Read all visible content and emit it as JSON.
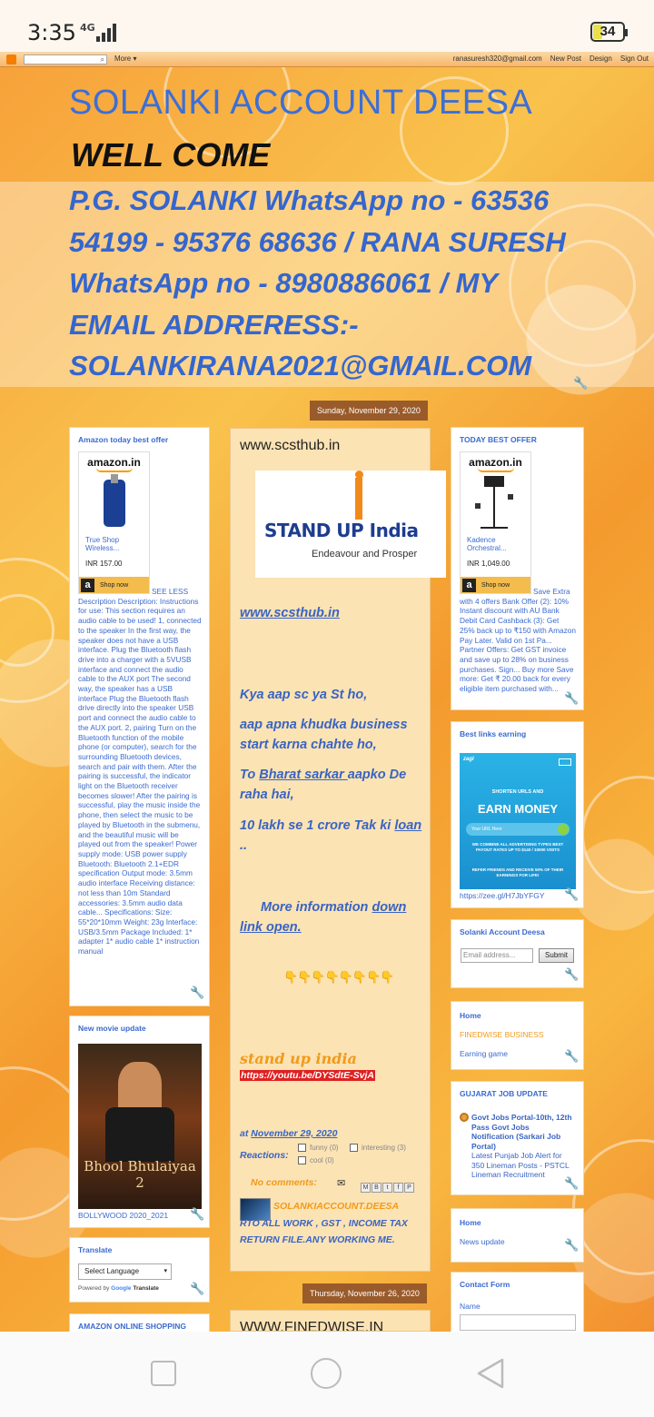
{
  "status": {
    "time": "3:35",
    "network": "4G",
    "battery": "34"
  },
  "navbar": {
    "search_placeholder": "",
    "more_label": "More ▾",
    "email": "ranasuresh320@gmail.com",
    "new_post": "New Post",
    "design": "Design",
    "sign_out": "Sign Out"
  },
  "header": {
    "title": "SOLANKI ACCOUNT DEESA",
    "welcome": "WELL COME",
    "description": "P.G. SOLANKI WhatsApp no - 63536 54199 - 95376 68636 / RANA SURESH WhatsApp no - 8980886061 / MY EMAIL ADDRERESS:- SOLANKIRANA2021@GMAIL.COM"
  },
  "left": {
    "amazon_widget": {
      "title": "Amazon today best offer",
      "logo": "amazon.in",
      "product": "True Shop Wireless...",
      "price": "INR 157.00",
      "shop_now": "Shop now",
      "see_less": "SEE LESS",
      "description": "Description Description: Instructions for use: This section requires an audio cable to be used! 1, connected to the speaker In the first way, the speaker does not have a USB interface. Plug the Bluetooth flash drive into a charger with a 5VUSB interface and connect the audio cable to the AUX port The second way, the speaker has a USB interface Plug the Bluetooth flash drive directly into the speaker USB port and connect the audio cable to the AUX port. 2, pairing Turn on the Bluetooth function of the mobile phone (or computer), search for the surrounding Bluetooth devices, search and pair with them. After the pairing is successful, the indicator light on the Bluetooth receiver becomes slower! After the pairing is successful, play the music inside the phone, then select the music to be played by Bluetooth in the submenu, and the beautiful music will be played out from the speaker! Power supply mode: USB power supply Bluetooth: Bluetooth 2.1+EDR specification Output mode: 3.5mm audio interface Receiving distance: not less than 10m Standard accessories: 3.5mm audio data cable... Specifications: Size: 55*20*10mm Weight: 23g Interface: USB/3.5mm Package Included: 1* adapter 1* audio cable 1* instruction manual"
    },
    "movie_widget": {
      "title": "New movie update",
      "poster_title": "Bhool Bhulaiyaa 2",
      "caption": "BOLLYWOOD 2020_2021"
    },
    "translate_widget": {
      "title": "Translate",
      "select": "Select Language",
      "powered_by": "Powered by",
      "google": "Google",
      "translate": "Translate"
    },
    "amazon_shopping": {
      "title": "AMAZON ONLINE SHOPPING"
    }
  },
  "post1": {
    "date": "Sunday, November 29, 2020",
    "title": "www.scsthub.in",
    "banner_main": "STAND UP India",
    "banner_sub": "Endeavour and Prosper",
    "link": "www.scsthub.in",
    "line1": "Kya aap sc ya St ho,",
    "line2": "aap apna khudka business start karna chahte ho,",
    "line3a": "To ",
    "line3b": "Bharat sarkar ",
    "line3c": " aapko De raha hai,",
    "line4a": "10 lakh se 1 crore Tak ki ",
    "line4b": "loan ",
    "line4c": "..",
    "line5a": "More information ",
    "line5b": "down link open.",
    "hands": "👇👇👇👇👇👇👇👇",
    "stand_up": "stand up india",
    "youtube": "https://youtu.be/DYSdtE-SvjA",
    "at": "at",
    "posted_date": "November 29, 2020",
    "reactions": "Reactions:",
    "funny": "funny (0)",
    "interesting": "interesting (3)",
    "cool": "cool (0)",
    "comments": "No comments:",
    "author": "SOLANKIACCOUNT.DEESA",
    "author_desc": "RTO ALL WORK , GST , INCOME TAX RETURN FILE.ANY WORKING ME."
  },
  "post2": {
    "date": "Thursday, November 26, 2020",
    "title": "WWW.FINEDWISE.IN"
  },
  "right": {
    "best_offer": {
      "title": "TODAY BEST OFFER",
      "logo": "amazon.in",
      "product": "Kadence Orchestral...",
      "price": "INR 1,049.00",
      "shop_now": "Shop now",
      "description": "Save Extra with 4 offers Bank Offer (2): 10% Instant discount with AU Bank Debit Card Cashback (3): Get 25% back up to ₹150 with Amazon Pay Later. Valid on 1st Pa... Partner Offers: Get GST invoice and save up to 28% on business purchases. Sign... Buy more Save more: Get ₹ 20.00 back for every eligible item purchased with..."
    },
    "earning": {
      "title": "Best links earning",
      "brand": "zagl",
      "shorten": "SHORTEN URLS AND",
      "earn": "EARN MONEY",
      "url_placeholder": "Your URL Here",
      "combine": "WE COMBINE ALL ADVERTISING TYPES BEST PAYOUT RATES UP TO $140 / 10000 VISITS",
      "refer": "REFER FRIENDS AND RECEIVE 50% OF THEIR EARNINGS FOR LIFE!",
      "link": "https://zee.gl/H7JbYFGY"
    },
    "subscribe": {
      "title": "Solanki Account Deesa",
      "placeholder": "Email address...",
      "submit": "Submit"
    },
    "links1": {
      "items": [
        "Home",
        "FINEDWISE BUSINESS",
        "Earning game"
      ]
    },
    "gujarat": {
      "title": "GUJARAT JOB UPDATE",
      "headline": "Govt Jobs Portal-10th, 12th Pass Govt Jobs Notification (Sarkari Job Portal)",
      "sub": "Latest Punjab Job Alert for 350 Lineman Posts - PSTCL Lineman Recruitment"
    },
    "links2": {
      "items": [
        "Home",
        "News update"
      ]
    },
    "contact": {
      "title": "Contact Form",
      "name_label": "Name"
    }
  }
}
